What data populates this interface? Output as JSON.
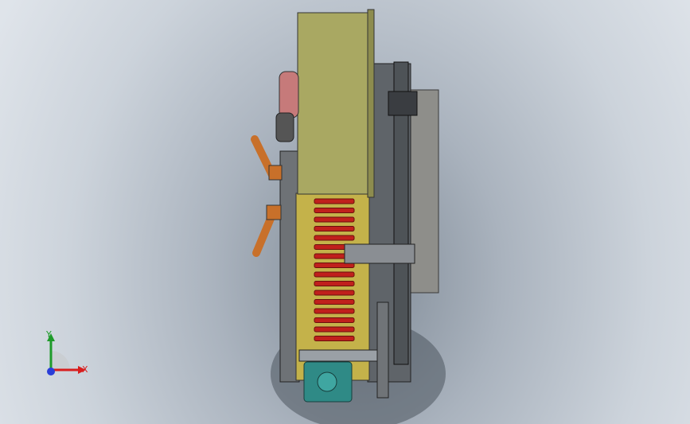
{
  "viewport": {
    "background_top": "#dfe4ea",
    "background_center": "#7f8a96"
  },
  "triad": {
    "x_label": "X",
    "y_label": "Y",
    "x_color": "#d81e1e",
    "y_color": "#1e9b2a",
    "z_color": "#2a3ed8"
  },
  "model": {
    "roll_color": "#a9a862",
    "frame_color": "#6e7276",
    "blade_color": "#c0201c",
    "handle_color": "#c8702a",
    "guide_color": "#c4b24a",
    "gear_color": "#2f8a86"
  }
}
